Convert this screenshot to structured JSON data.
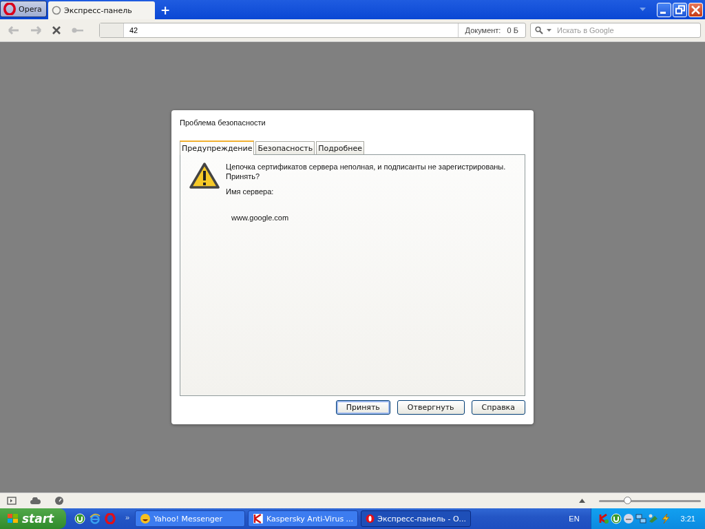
{
  "browser": {
    "menu_button": "Opera",
    "tabs": [
      {
        "label": "Экспресс-панель",
        "selected": true
      }
    ],
    "new_tab": "+",
    "address": {
      "value": "42"
    },
    "document_info": {
      "label": "Документ:",
      "value": "0 Б"
    },
    "search": {
      "placeholder": "Искать в Google"
    }
  },
  "dialog": {
    "title": "Проблема безопасности",
    "tabs": [
      {
        "label": "Предупреждение",
        "selected": true
      },
      {
        "label": "Безопасность",
        "selected": false
      },
      {
        "label": "Подробнее",
        "selected": false
      }
    ],
    "message": "Цепочка сертификатов сервера неполная, и подписанты не зарегистрированы. Принять?",
    "server_label": "Имя сервера:",
    "server_name": "www.google.com",
    "buttons": [
      {
        "label": "Принять",
        "default": true
      },
      {
        "label": "Отвергнуть",
        "default": false
      },
      {
        "label": "Справка",
        "default": false
      }
    ]
  },
  "status_bar": {
    "zoom": {
      "level": 0.28
    }
  },
  "taskbar": {
    "start": "start",
    "more": "»",
    "tasks": [
      {
        "label": "Yahoo! Messenger",
        "kind": "yahoo",
        "selected": false
      },
      {
        "label": "Kaspersky Anti-Virus ...",
        "kind": "kaspersky",
        "selected": false
      },
      {
        "label": "Экспресс-панель - О...",
        "kind": "opera",
        "selected": true
      }
    ],
    "language": "EN",
    "clock": "3:21"
  }
}
